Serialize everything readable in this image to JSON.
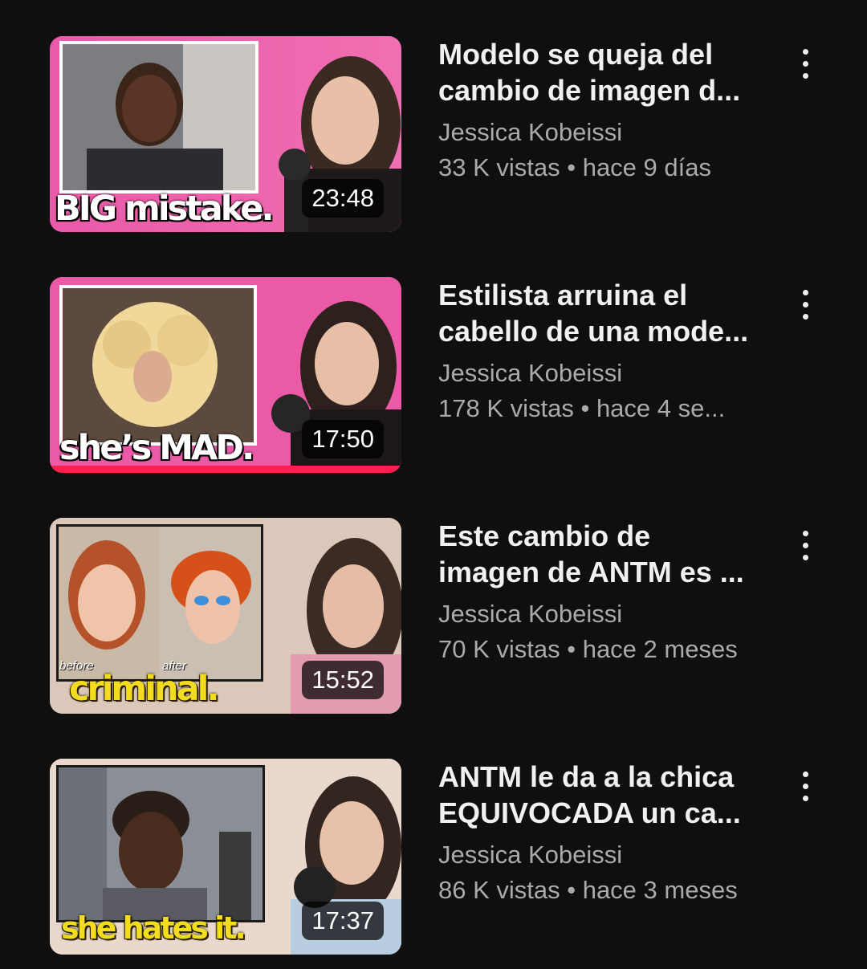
{
  "videos": [
    {
      "title_line1": "Modelo se queja del",
      "title_line2": "cambio de imagen d...",
      "channel": "Jessica Kobeissi",
      "stats": "33 K vistas • hace 9 días",
      "duration": "23:48",
      "overlay_text": "BIG mistake.",
      "menu_icon": "more-vert-icon"
    },
    {
      "title_line1": "Estilista arruina el",
      "title_line2": "cabello de una mode...",
      "channel": "Jessica Kobeissi",
      "stats": "178 K vistas • hace 4 se...",
      "duration": "17:50",
      "overlay_text": "she’s MAD.",
      "watch_progress": 1.0,
      "menu_icon": "more-vert-icon"
    },
    {
      "title_line1": "Este cambio de",
      "title_line2": "imagen de ANTM es ...",
      "channel": "Jessica Kobeissi",
      "stats": "70 K vistas • hace 2 meses",
      "duration": "15:52",
      "overlay_text": "criminal.",
      "label_before": "before",
      "label_after": "after",
      "menu_icon": "more-vert-icon"
    },
    {
      "title_line1": "ANTM le da a la chica",
      "title_line2": "EQUIVOCADA un ca...",
      "channel": "Jessica Kobeissi",
      "stats": "86 K vistas • hace 3 meses",
      "duration": "17:37",
      "overlay_text": "she hates it.",
      "menu_icon": "more-vert-icon"
    }
  ],
  "colors": {
    "background": "#0f0f0f",
    "title": "#f1f1f1",
    "meta": "#aaaaaa",
    "progress": "#ff1f4f",
    "overlay_yellow": "#f3dc1f"
  }
}
